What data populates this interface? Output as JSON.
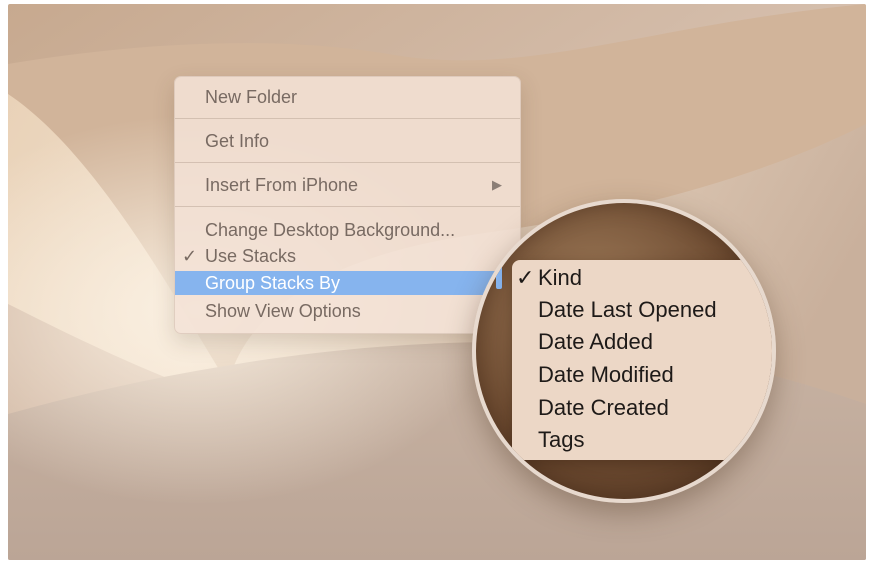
{
  "context_menu": {
    "items": [
      {
        "label": "New Folder"
      },
      {
        "label": "Get Info"
      },
      {
        "label": "Insert From iPhone",
        "submenu_arrow": "▶"
      },
      {
        "label": "Change Desktop Background..."
      },
      {
        "label": "Use Stacks",
        "check": "✓"
      },
      {
        "label": "Group Stacks By",
        "submenu_arrow": "▶"
      },
      {
        "label": "Show View Options"
      }
    ],
    "highlight_color": "#86b4ee"
  },
  "magnified_submenu": {
    "items": [
      {
        "label": "Kind",
        "check": "✓"
      },
      {
        "label": "Date Last Opened"
      },
      {
        "label": "Date Added"
      },
      {
        "label": "Date Modified"
      },
      {
        "label": "Date Created"
      },
      {
        "label": "Tags"
      }
    ]
  }
}
